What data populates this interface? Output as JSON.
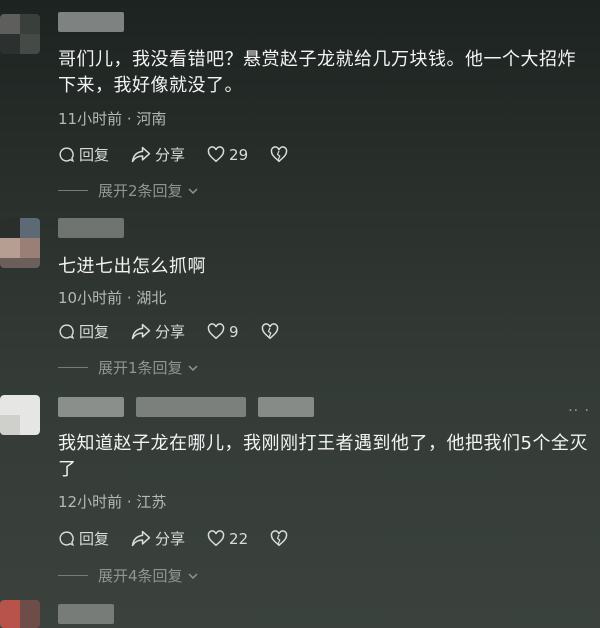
{
  "comments": [
    {
      "text": "哥们儿，我没看错吧？悬赏赵子龙就给几万块钱。他一个大招炸下来，我好像就没了。",
      "meta": "11小时前 · 河南",
      "reply_label": "回复",
      "share_label": "分享",
      "likes": "29",
      "expand_label": "展开2条回复"
    },
    {
      "text": "七进七出怎么抓啊",
      "meta": "10小时前 · 湖北",
      "reply_label": "回复",
      "share_label": "分享",
      "likes": "9",
      "expand_label": "展开1条回复"
    },
    {
      "text": "我知道赵子龙在哪儿，我刚刚打王者遇到他了，他把我们5个全灭了",
      "meta": "12小时前 · 江苏",
      "reply_label": "回复",
      "share_label": "分享",
      "likes": "22",
      "expand_label": "展开4条回复"
    }
  ],
  "more_glyph": "·· ·",
  "colors": {
    "background": "#2f3632",
    "text": "#f3f3f3",
    "meta": "#b5b9b6"
  },
  "icons": [
    "comment-icon",
    "share-icon",
    "heart-icon",
    "broken-heart-icon",
    "chevron-down-icon"
  ]
}
